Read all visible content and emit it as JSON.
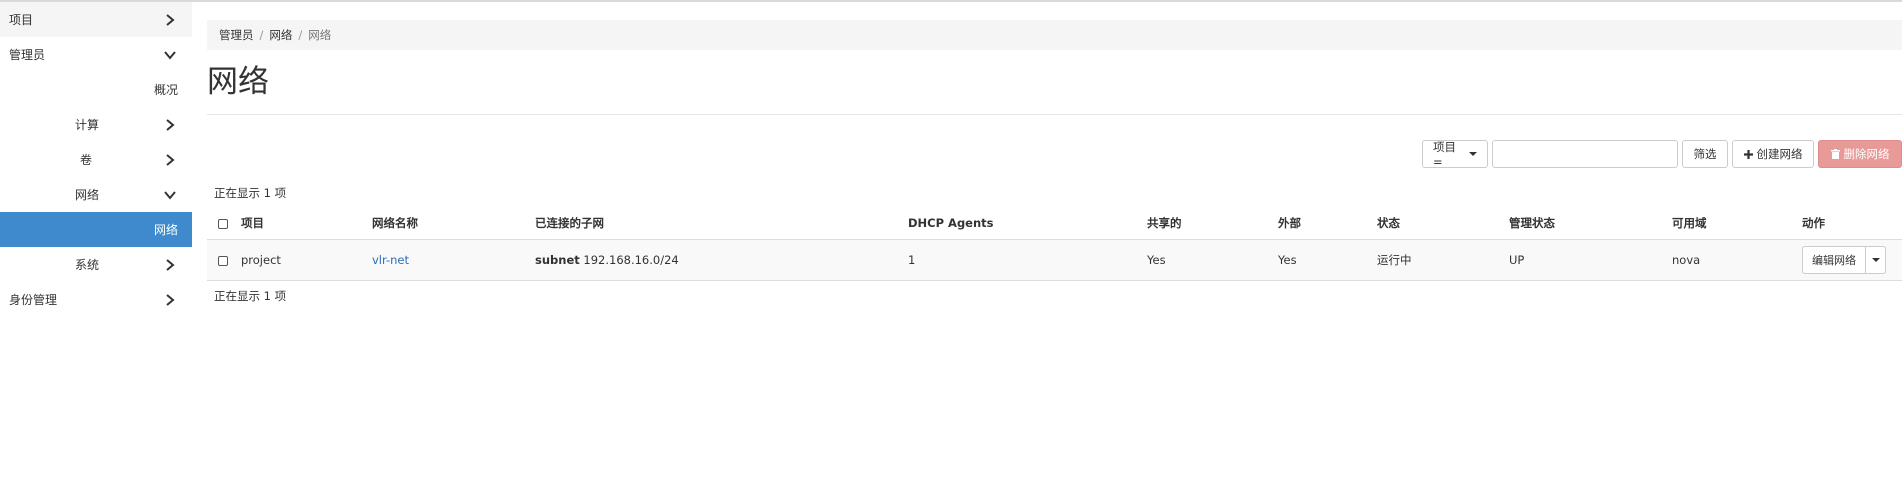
{
  "sidebar": {
    "items": [
      {
        "label": "项目"
      },
      {
        "label": "管理员"
      },
      {
        "label": "概况"
      },
      {
        "label": "计算"
      },
      {
        "label": "卷"
      },
      {
        "label": "网络"
      },
      {
        "label": "网络"
      },
      {
        "label": "系统"
      },
      {
        "label": "身份管理"
      }
    ]
  },
  "breadcrumb": [
    "管理员",
    "网络",
    "网络"
  ],
  "page": {
    "title": "网络"
  },
  "toolbar": {
    "filter_field": "项目 =",
    "filter_value": "",
    "filter_label": "筛选",
    "create_label": "创建网络",
    "delete_label": "删除网络"
  },
  "table": {
    "count_text": "正在显示 1 项",
    "columns": [
      "项目",
      "网络名称",
      "已连接的子网",
      "DHCP Agents",
      "共享的",
      "外部",
      "状态",
      "管理状态",
      "可用域",
      "动作"
    ],
    "rows": [
      {
        "project": "project",
        "name": "vlr-net",
        "subnet_name": "subnet",
        "subnet_cidr": "192.168.16.0/24",
        "dhcp_agents": "1",
        "shared": "Yes",
        "external": "Yes",
        "status": "运行中",
        "admin_state": "UP",
        "zone": "nova",
        "action_label": "编辑网络"
      }
    ]
  },
  "colors": {
    "active_nav": "#3e8acc",
    "link": "#2a6ebb",
    "danger_disabled": "#e89a98"
  },
  "icons": [
    "chevron-right-icon",
    "chevron-down-icon",
    "plus-icon",
    "trash-icon",
    "caret-down-icon",
    "checkbox-icon"
  ]
}
